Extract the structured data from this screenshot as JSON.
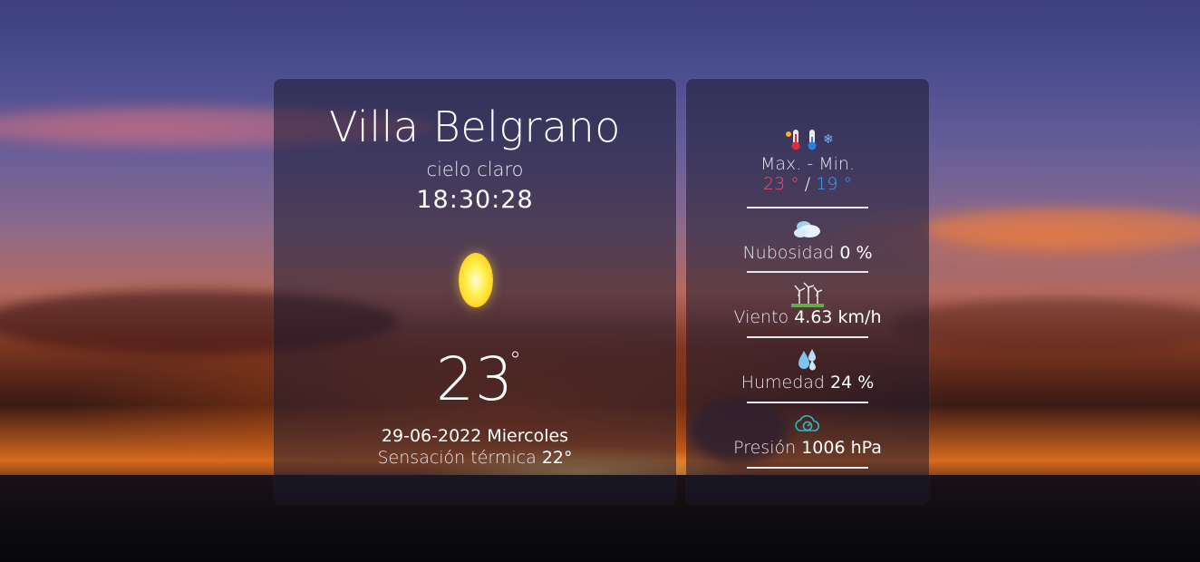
{
  "weather": {
    "city": "Villa Belgrano",
    "description": "cielo claro",
    "time": "18:30:28",
    "temperature": "23",
    "degree_symbol": "°",
    "date": "29-06-2022 Miercoles",
    "feels_like_label": "Sensación térmica",
    "feels_like_value": "22°",
    "icon": "sun-icon"
  },
  "details": {
    "maxmin": {
      "label": "Max. - Min.",
      "max": "23 °",
      "separator": "/",
      "min": "19 °",
      "icon": "thermometer-hot-cold-icon",
      "max_color": "#ff4c5e",
      "min_color": "#3aa2ff"
    },
    "clouds": {
      "label": "Nubosidad",
      "value": "0 %",
      "icon": "cloud-icon"
    },
    "wind": {
      "label": "Viento",
      "value": "4.63 km/h",
      "icon": "wind-turbine-icon"
    },
    "humidity": {
      "label": "Humedad",
      "value": "24 %",
      "icon": "water-drops-icon"
    },
    "pressure": {
      "label": "Presión",
      "value": "1006 hPa",
      "icon": "pressure-gauge-icon"
    }
  }
}
